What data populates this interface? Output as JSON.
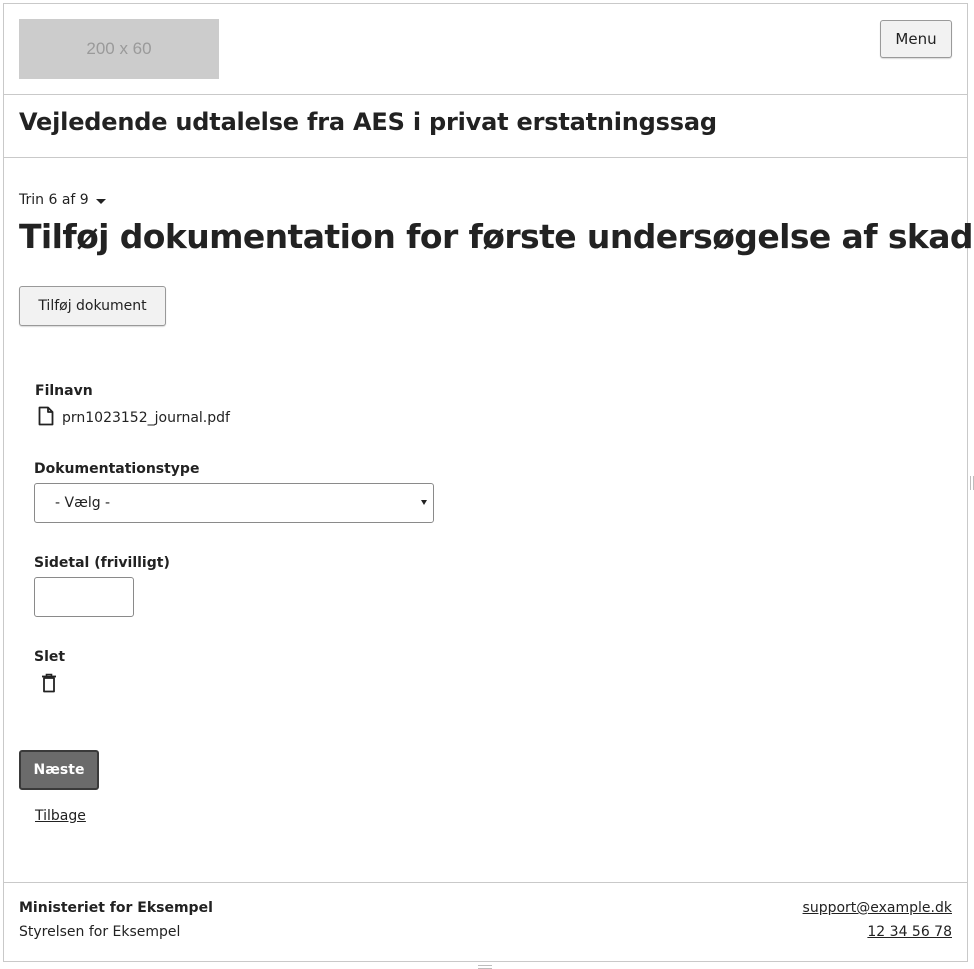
{
  "header": {
    "logo_text": "200 x 60",
    "menu_label": "Menu"
  },
  "service_title": "Vejledende udtalelse fra AES i privat erstatningssag",
  "progress": {
    "step_label": "Trin 6 af 9",
    "current_step": 6,
    "total_steps": 9
  },
  "page_title": "Tilføj dokumentation for første undersøgelse af skaden",
  "add_document_label": "Tilføj dokument",
  "document": {
    "filename_label": "Filnavn",
    "filename": "prn1023152_journal.pdf",
    "file_icon": "file-icon",
    "doc_type_label": "Dokumentationstype",
    "doc_type_selected": "- Vælg -",
    "page_number_label": "Sidetal (frivilligt)",
    "page_number_value": "",
    "delete_label": "Slet",
    "delete_icon": "trash-icon"
  },
  "actions": {
    "next_label": "Næste",
    "back_label": "Tilbage"
  },
  "footer": {
    "org_name": "Ministeriet for Eksempel",
    "agency_name": "Styrelsen for Eksempel",
    "email": "support@example.dk",
    "phone": "12 34 56 78"
  },
  "colors": {
    "primary_button": "#6b6b6b",
    "border": "#c9c9c9",
    "logo_placeholder": "#cccccc"
  }
}
